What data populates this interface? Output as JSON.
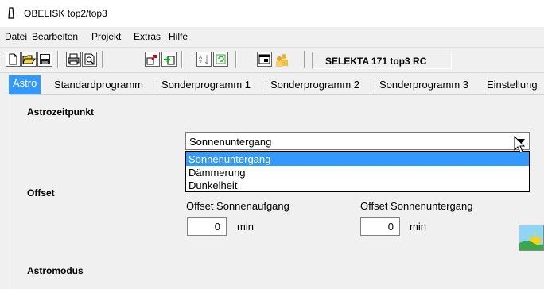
{
  "window": {
    "title": "OBELISK top2/top3"
  },
  "menu": [
    "Datei",
    "Bearbeiten",
    "Projekt",
    "Extras",
    "Hilfe"
  ],
  "toolbar": {
    "device_label": "SELEKTA 171 top3 RC",
    "icons": [
      "new-document-icon",
      "open-folder-icon",
      "save-icon",
      "print-icon",
      "print-preview-icon",
      "upload-icon",
      "download-icon",
      "sort-icon",
      "refresh-icon",
      "window-icon",
      "users-icon"
    ]
  },
  "tabs": [
    {
      "label": "Astro",
      "active": true
    },
    {
      "label": "Standardprogramm",
      "active": false
    },
    {
      "label": "Sonderprogramm 1",
      "active": false
    },
    {
      "label": "Sonderprogramm 2",
      "active": false
    },
    {
      "label": "Sonderprogramm 3",
      "active": false
    },
    {
      "label": "Einstellung",
      "active": false
    }
  ],
  "astro": {
    "astrozeitpunkt_label": "Astrozeitpunkt",
    "dropdown": {
      "selected": "Sonnenuntergang",
      "options": [
        "Sonnenuntergang",
        "Dämmerung",
        "Dunkelheit"
      ],
      "highlighted_index": 0
    },
    "offset_label": "Offset",
    "offset_sunrise": {
      "label": "Offset  Sonnenaufgang",
      "value": "0",
      "unit": "min"
    },
    "offset_sunset": {
      "label": "Offset  Sonnenuntergang",
      "value": "0",
      "unit": "min"
    },
    "astromodus_label": "Astromodus"
  },
  "colors": {
    "selection": "#3399ff",
    "background": "#f0f0f0"
  }
}
